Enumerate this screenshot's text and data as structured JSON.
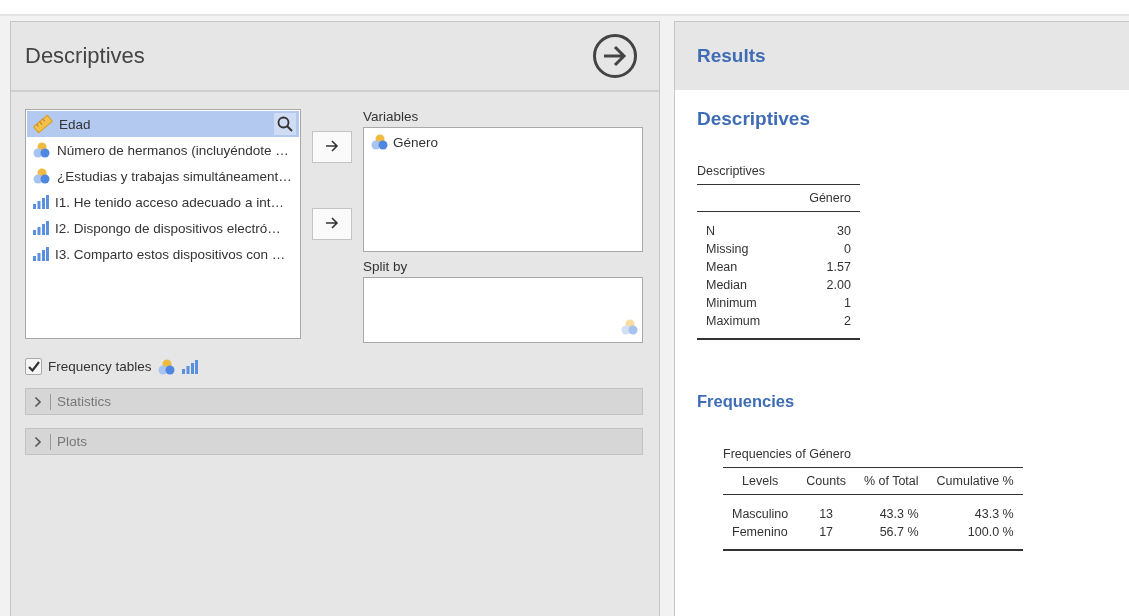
{
  "analysis": {
    "title": "Descriptives"
  },
  "source_variables": [
    {
      "name": "Edad",
      "kind": "continuous",
      "selected": true
    },
    {
      "name": "Número de hermanos (incluyéndote …",
      "kind": "nominal",
      "selected": false
    },
    {
      "name": "¿Estudias y trabajas simultáneament…",
      "kind": "nominal",
      "selected": false
    },
    {
      "name": "I1. He tenido acceso adecuado a int…",
      "kind": "ordinal",
      "selected": false
    },
    {
      "name": "I2. Dispongo de dispositivos electró…",
      "kind": "ordinal",
      "selected": false
    },
    {
      "name": "I3. Comparto estos dispositivos con …",
      "kind": "ordinal",
      "selected": false
    }
  ],
  "targets": [
    {
      "label": "Variables",
      "variables": [
        {
          "name": "Género",
          "kind": "nominal"
        }
      ]
    },
    {
      "label": "Split by"
    }
  ],
  "frequency_tables": {
    "label": "Frequency tables",
    "checked": true
  },
  "sections": [
    {
      "label": "Statistics",
      "expanded": false
    },
    {
      "label": "Plots",
      "expanded": false
    }
  ],
  "results": {
    "title": "Results",
    "heading": "Descriptives",
    "descriptives_table": {
      "title": "Descriptives",
      "columns": [
        "",
        "Género"
      ],
      "rows": [
        [
          "N",
          "30"
        ],
        [
          "Missing",
          "0"
        ],
        [
          "Mean",
          "1.57"
        ],
        [
          "Median",
          "2.00"
        ],
        [
          "Minimum",
          "1"
        ],
        [
          "Maximum",
          "2"
        ]
      ]
    },
    "frequencies_heading": "Frequencies",
    "frequencies_table": {
      "title": "Frequencies of Género",
      "columns": [
        "Levels",
        "Counts",
        "% of Total",
        "Cumulative %"
      ],
      "rows": [
        [
          "Masculino",
          "13",
          "43.3 %",
          "43.3 %"
        ],
        [
          "Femenino",
          "17",
          "56.7 %",
          "100.0 %"
        ]
      ]
    }
  }
}
